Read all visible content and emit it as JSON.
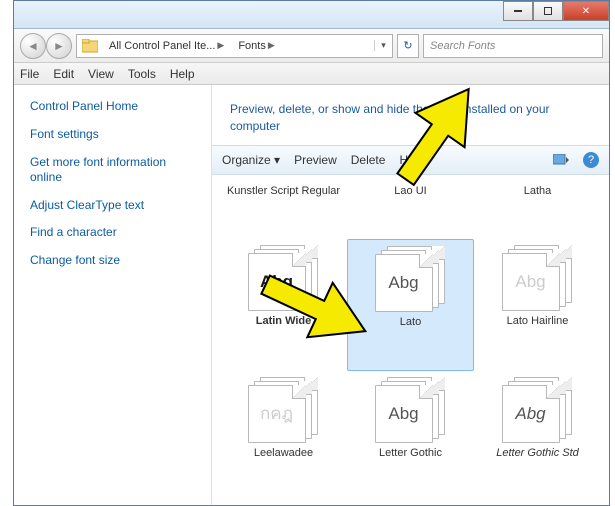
{
  "titlebar": {
    "min": "minimize",
    "max": "maximize",
    "close": "close"
  },
  "breadcrumb": {
    "item1": "All Control Panel Ite...",
    "item2": "Fonts"
  },
  "search": {
    "placeholder": "Search Fonts"
  },
  "menubar": {
    "file": "File",
    "edit": "Edit",
    "view": "View",
    "tools": "Tools",
    "help": "Help"
  },
  "sidebar": {
    "home": "Control Panel Home",
    "links": [
      "Font settings",
      "Get more font information online",
      "Adjust ClearType text",
      "Find a character",
      "Change font size"
    ]
  },
  "main": {
    "header": "Preview, delete, or show and hide the fonts installed on your computer"
  },
  "toolbar": {
    "organize": "Organize",
    "preview": "Preview",
    "delete": "Delete",
    "hide": "Hide"
  },
  "fonts": [
    {
      "label": "Kunstler Script Regular",
      "sample": "",
      "stack": false,
      "class": ""
    },
    {
      "label": "Lao UI",
      "sample": "",
      "stack": true,
      "class": ""
    },
    {
      "label": "Latha",
      "sample": "",
      "stack": true,
      "class": ""
    },
    {
      "label": "Latin Wide",
      "sample": "Abg",
      "stack": true,
      "class": "bold-sample"
    },
    {
      "label": "Lato",
      "sample": "Abg",
      "stack": true,
      "class": "",
      "selected": true
    },
    {
      "label": "Lato Hairline",
      "sample": "Abg",
      "stack": true,
      "class": "faded"
    },
    {
      "label": "Leelawadee",
      "sample": "กคฎ",
      "stack": true,
      "class": "thai-sample faded"
    },
    {
      "label": "Letter Gothic",
      "sample": "Abg",
      "stack": true,
      "class": ""
    },
    {
      "label": "Letter Gothic Std",
      "sample": "Abg",
      "stack": true,
      "class": "italic-sample"
    }
  ]
}
